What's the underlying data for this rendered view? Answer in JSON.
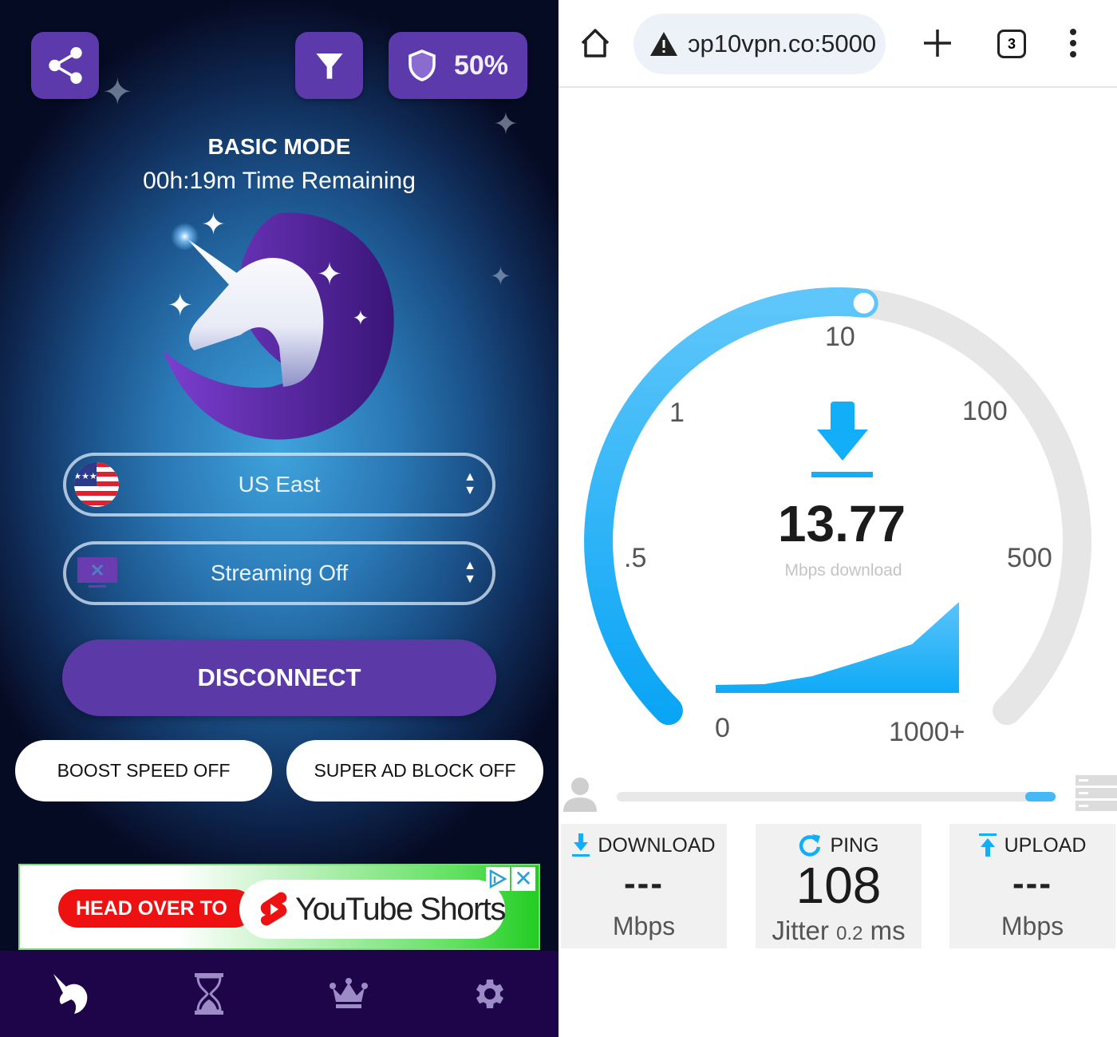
{
  "vpn_app": {
    "top_bar": {
      "share_icon": "share-icon",
      "filter_icon": "filter-icon",
      "shield_icon": "shield-icon",
      "protection_percent": "50%"
    },
    "mode_title": "BASIC MODE",
    "time_remaining": "00h:19m Time Remaining",
    "server_select": {
      "value": "US East",
      "icon": "us-flag-icon"
    },
    "streaming_select": {
      "value": "Streaming Off",
      "icon": "tv-off-icon"
    },
    "disconnect_label": "DISCONNECT",
    "boost_speed_label": "BOOST SPEED OFF",
    "ad_block_label": "SUPER AD BLOCK OFF",
    "ad": {
      "head_text": "HEAD OVER TO",
      "brand_text": "YouTube Shorts"
    },
    "bottom_nav": [
      {
        "name": "home",
        "icon": "unicorn-icon",
        "active": true
      },
      {
        "name": "time",
        "icon": "hourglass-icon",
        "active": false
      },
      {
        "name": "premium",
        "icon": "crown-icon",
        "active": false
      },
      {
        "name": "settings",
        "icon": "gear-icon",
        "active": false
      }
    ],
    "colors": {
      "accent": "#5b3aa8",
      "nav_bg": "#1e0549"
    }
  },
  "browser": {
    "url": "ɔp10vpn.co:5000",
    "tab_count": "3",
    "warning_icon": "warning-icon"
  },
  "speedtest": {
    "current_speed": "13.77",
    "current_speed_unit": "Mbps download",
    "gauge": {
      "scale_labels": [
        "0",
        ".5",
        "1",
        "10",
        "100",
        "500",
        "1000+"
      ],
      "current_value_mbps": 13.77
    },
    "test_progress_fraction": 0.07,
    "download": {
      "label": "DOWNLOAD",
      "value": "---",
      "unit": "Mbps"
    },
    "ping": {
      "label": "PING",
      "value": "108",
      "jitter_label": "Jitter",
      "jitter_value": "0.2",
      "jitter_unit": "ms"
    },
    "upload": {
      "label": "UPLOAD",
      "value": "---",
      "unit": "Mbps"
    },
    "colors": {
      "accent": "#12aef7",
      "track": "#e6e6e6"
    }
  }
}
